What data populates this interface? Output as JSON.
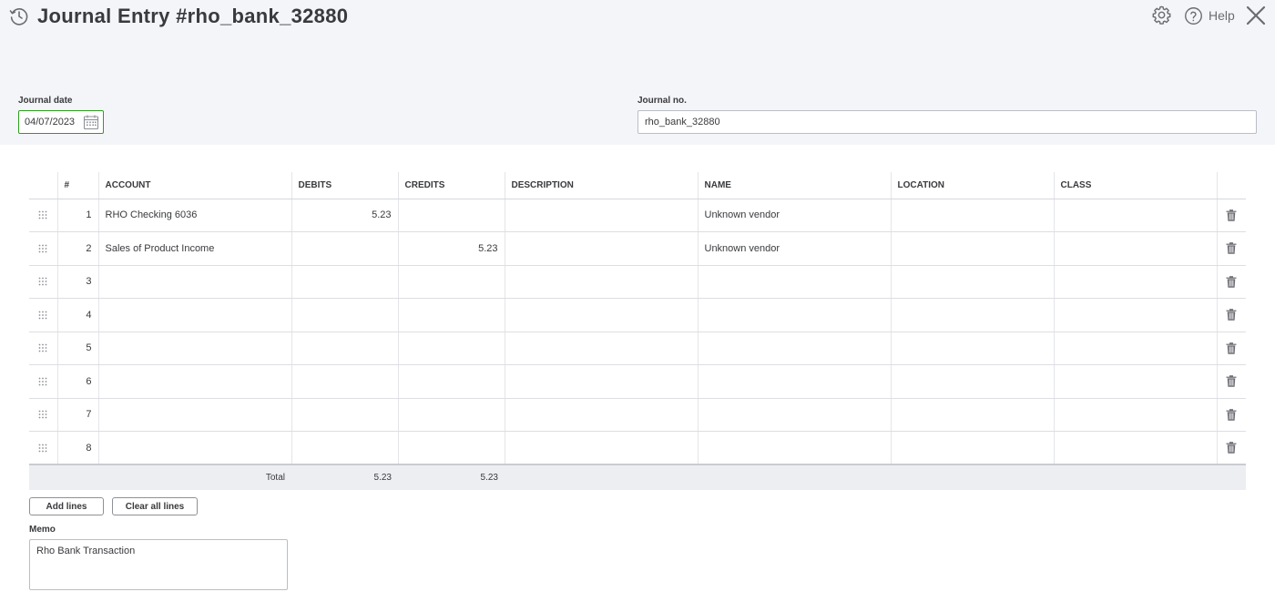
{
  "header": {
    "title": "Journal Entry #rho_bank_32880",
    "help_label": "Help"
  },
  "form": {
    "date_label": "Journal date",
    "date_value": "04/07/2023",
    "journal_no_label": "Journal no.",
    "journal_no_value": "rho_bank_32880"
  },
  "table": {
    "columns": [
      "#",
      "ACCOUNT",
      "DEBITS",
      "CREDITS",
      "DESCRIPTION",
      "NAME",
      "LOCATION",
      "CLASS"
    ],
    "rows": [
      {
        "n": "1",
        "account": "RHO Checking 6036",
        "debit": "5.23",
        "credit": "",
        "description": "",
        "name": "Unknown vendor",
        "location": "",
        "class": ""
      },
      {
        "n": "2",
        "account": "Sales of Product Income",
        "debit": "",
        "credit": "5.23",
        "description": "",
        "name": "Unknown vendor",
        "location": "",
        "class": ""
      },
      {
        "n": "3",
        "account": "",
        "debit": "",
        "credit": "",
        "description": "",
        "name": "",
        "location": "",
        "class": ""
      },
      {
        "n": "4",
        "account": "",
        "debit": "",
        "credit": "",
        "description": "",
        "name": "",
        "location": "",
        "class": ""
      },
      {
        "n": "5",
        "account": "",
        "debit": "",
        "credit": "",
        "description": "",
        "name": "",
        "location": "",
        "class": ""
      },
      {
        "n": "6",
        "account": "",
        "debit": "",
        "credit": "",
        "description": "",
        "name": "",
        "location": "",
        "class": ""
      },
      {
        "n": "7",
        "account": "",
        "debit": "",
        "credit": "",
        "description": "",
        "name": "",
        "location": "",
        "class": ""
      },
      {
        "n": "8",
        "account": "",
        "debit": "",
        "credit": "",
        "description": "",
        "name": "",
        "location": "",
        "class": ""
      }
    ],
    "total_label": "Total",
    "total_debits": "5.23",
    "total_credits": "5.23"
  },
  "buttons": {
    "add_lines": "Add lines",
    "clear_all_lines": "Clear all lines"
  },
  "memo": {
    "label": "Memo",
    "value": "Rho Bank Transaction"
  },
  "icons": {
    "history": "history-icon",
    "settings": "gear-icon",
    "help": "help-icon",
    "close": "close-icon",
    "calendar": "calendar-icon",
    "drag": "drag-handle-icon",
    "delete": "trash-icon"
  },
  "colors": {
    "accent_green": "#2ca01c",
    "header_bg": "#f4f5f8",
    "text": "#393a3d"
  }
}
